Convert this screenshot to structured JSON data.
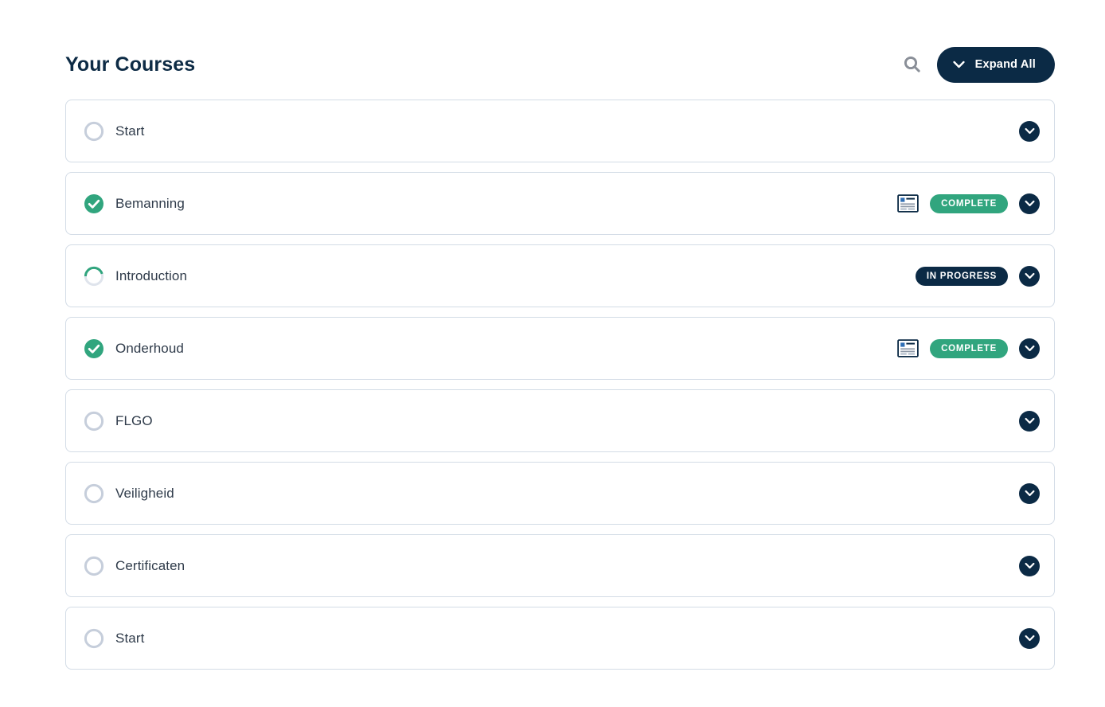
{
  "header": {
    "title": "Your Courses",
    "search_icon": "search-icon",
    "expand_all_label": "Expand All",
    "expand_all_icon": "chevron-down-icon"
  },
  "colors": {
    "navy": "#0b2a45",
    "green": "#31a57e",
    "border": "#d3dce6",
    "ring_empty": "#c6cedb",
    "label_text": "#2f3b4a",
    "title_text": "#0d2b45",
    "search_icon": "#8a8f98",
    "background": "#ffffff"
  },
  "courses": [
    {
      "label": "Start",
      "status": "not-started",
      "status_icon": "empty-circle-icon",
      "progress": 0,
      "badge": null,
      "has_certificate": false,
      "toggle_icon": "chevron-down-icon"
    },
    {
      "label": "Bemanning",
      "status": "complete",
      "status_icon": "check-circle-icon",
      "progress": 100,
      "badge": "COMPLETE",
      "has_certificate": true,
      "certificate_icon": "certificate-icon",
      "toggle_icon": "chevron-down-icon"
    },
    {
      "label": "Introduction",
      "status": "in-progress",
      "status_icon": "progress-ring-icon",
      "progress": 45,
      "badge": "IN PROGRESS",
      "has_certificate": false,
      "toggle_icon": "chevron-down-icon"
    },
    {
      "label": "Onderhoud",
      "status": "complete",
      "status_icon": "check-circle-icon",
      "progress": 100,
      "badge": "COMPLETE",
      "has_certificate": true,
      "certificate_icon": "certificate-icon",
      "toggle_icon": "chevron-down-icon"
    },
    {
      "label": "FLGO",
      "status": "not-started",
      "status_icon": "empty-circle-icon",
      "progress": 0,
      "badge": null,
      "has_certificate": false,
      "toggle_icon": "chevron-down-icon"
    },
    {
      "label": "Veiligheid",
      "status": "not-started",
      "status_icon": "empty-circle-icon",
      "progress": 0,
      "badge": null,
      "has_certificate": false,
      "toggle_icon": "chevron-down-icon"
    },
    {
      "label": "Certificaten",
      "status": "not-started",
      "status_icon": "empty-circle-icon",
      "progress": 0,
      "badge": null,
      "has_certificate": false,
      "toggle_icon": "chevron-down-icon"
    },
    {
      "label": "Start",
      "status": "not-started",
      "status_icon": "empty-circle-icon",
      "progress": 0,
      "badge": null,
      "has_certificate": false,
      "toggle_icon": "chevron-down-icon"
    }
  ]
}
